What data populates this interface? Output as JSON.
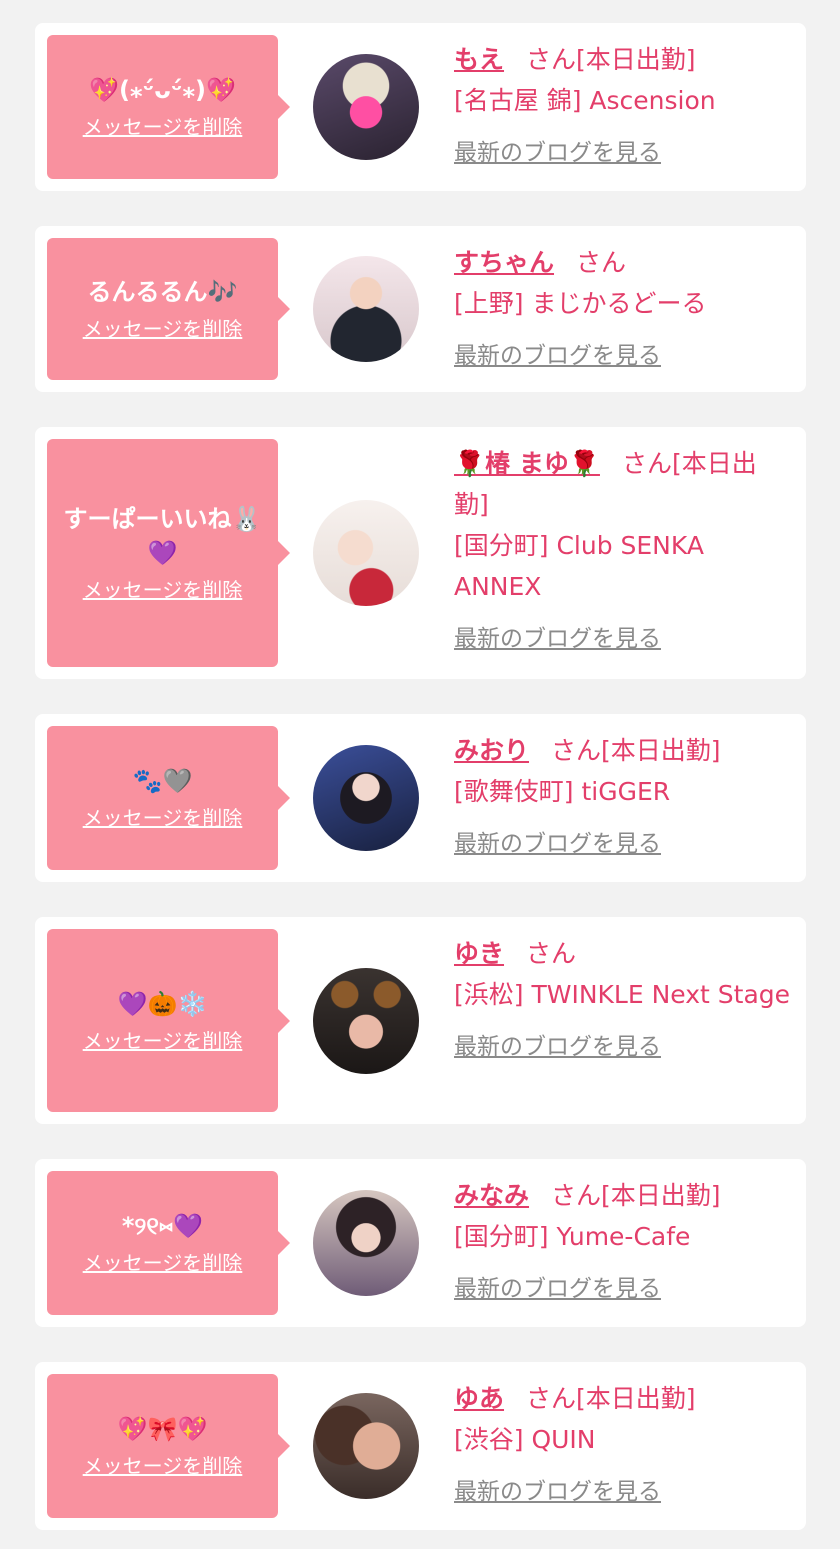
{
  "cards": [
    {
      "message": "💖(⁎ᵕ́ᴗᵕ́⁎)💖",
      "delete_label": "メッセージを削除",
      "name": "もえ",
      "honorific": "さん",
      "status": "[本日出勤]",
      "shop": "[名古屋 錦] Ascension",
      "blog_label": "最新のブログを見る"
    },
    {
      "message": "るんるるん🎶",
      "delete_label": "メッセージを削除",
      "name": "すちゃん",
      "honorific": "さん",
      "status": "",
      "shop": "[上野] まじかるどーる",
      "blog_label": "最新のブログを見る"
    },
    {
      "message": "すーぱーいいね🐰💜",
      "delete_label": "メッセージを削除",
      "name": "🌹椿 まゆ🌹",
      "honorific": "さん",
      "status": "[本日出勤]",
      "shop": "[国分町] Club SENKA ANNEX",
      "blog_label": "最新のブログを見る"
    },
    {
      "message": "🐾🩶",
      "delete_label": "メッセージを削除",
      "name": "みおり",
      "honorific": "さん",
      "status": "[本日出勤]",
      "shop": "[歌舞伎町] tiGGER",
      "blog_label": "最新のブログを見る"
    },
    {
      "message": "💜🎃❄️",
      "delete_label": "メッセージを削除",
      "name": "ゆき",
      "honorific": "さん",
      "status": "",
      "shop": "[浜松] TWINKLE Next Stage",
      "blog_label": "最新のブログを見る"
    },
    {
      "message": "*୨୧⑅💜",
      "delete_label": "メッセージを削除",
      "name": "みなみ",
      "honorific": "さん",
      "status": "[本日出勤]",
      "shop": "[国分町] Yume-Cafe",
      "blog_label": "最新のブログを見る"
    },
    {
      "message": "💖🎀💖",
      "delete_label": "メッセージを削除",
      "name": "ゆあ",
      "honorific": "さん",
      "status": "[本日出勤]",
      "shop": "[渋谷] QUIN",
      "blog_label": "最新のブログを見る"
    }
  ]
}
